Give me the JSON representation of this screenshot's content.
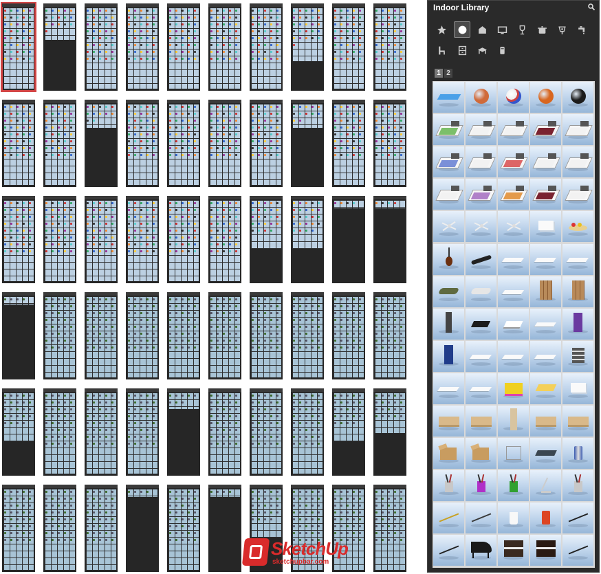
{
  "library": {
    "title": "Indoor Library",
    "pages": [
      "1",
      "2"
    ],
    "active_page": "1",
    "categories": [
      {
        "icon": "star-icon",
        "active": false
      },
      {
        "icon": "ball-icon",
        "active": true
      },
      {
        "icon": "bed-icon",
        "active": false
      },
      {
        "icon": "monitor-icon",
        "active": false
      },
      {
        "icon": "wine-glass-icon",
        "active": false
      },
      {
        "icon": "cooking-pot-icon",
        "active": false
      },
      {
        "icon": "wall-lamp-icon",
        "active": false
      },
      {
        "icon": "faucet-icon",
        "active": false
      },
      {
        "icon": "chair-icon",
        "active": false
      },
      {
        "icon": "cabinet-icon",
        "active": false
      },
      {
        "icon": "table-icon",
        "active": false
      },
      {
        "icon": "canister-icon",
        "active": false
      }
    ],
    "items": [
      "water-surface",
      "basketball",
      "volleyball",
      "orange-basketball",
      "bowling-ball",
      "green-bed",
      "white-bed",
      "white-bed",
      "dark-red-bed",
      "white-bed",
      "blue-bed",
      "white-bed",
      "red-bed",
      "white-bed",
      "white-bed",
      "white-bed",
      "purple-bed",
      "orange-bed",
      "dark-red-bed",
      "white-bed",
      "ceiling-fan",
      "ceiling-fan",
      "ceiling-fan",
      "white-box",
      "fruit-plate",
      "guitar",
      "skateboard",
      "white-mat",
      "white-mat",
      "white-mat",
      "green-cushion",
      "white-cushion",
      "round-mat",
      "folding-screen",
      "folding-screen",
      "tall-speaker",
      "black-book",
      "white-book",
      "white-paper",
      "purple-binder",
      "blue-binder",
      "white-paper-stack",
      "white-paper-stack",
      "white-paper-stack",
      "file-tray",
      "white-notebook",
      "white-paper",
      "yellow-box",
      "yellow-package",
      "white-box",
      "cardboard-box",
      "cardboard-box",
      "tall-box",
      "cardboard-box",
      "cardboard-box",
      "open-cardboard-box",
      "open-cardboard-box",
      "wire-frame",
      "dark-tray",
      "can",
      "pencil-cup",
      "pencil-cup",
      "pencil-cup",
      "desk-lamp",
      "pencil-cup",
      "pencil",
      "marker",
      "white-cup",
      "red-can",
      "pen",
      "dark-pen",
      "grand-piano",
      "upright-piano",
      "upright-piano",
      "dark-pen"
    ]
  },
  "overview": {
    "columns": 10,
    "rows": 6,
    "selected_index": 0
  },
  "watermark": {
    "brand": "SketchUp",
    "site": "sketchupbar.com"
  },
  "colors": {
    "panel_bg": "#2a2a2a",
    "thumb_bg": "#262626",
    "selected_outline": "#d24545",
    "cell_sky": "#bcd2ea",
    "watermark_red": "#d92b2b"
  }
}
